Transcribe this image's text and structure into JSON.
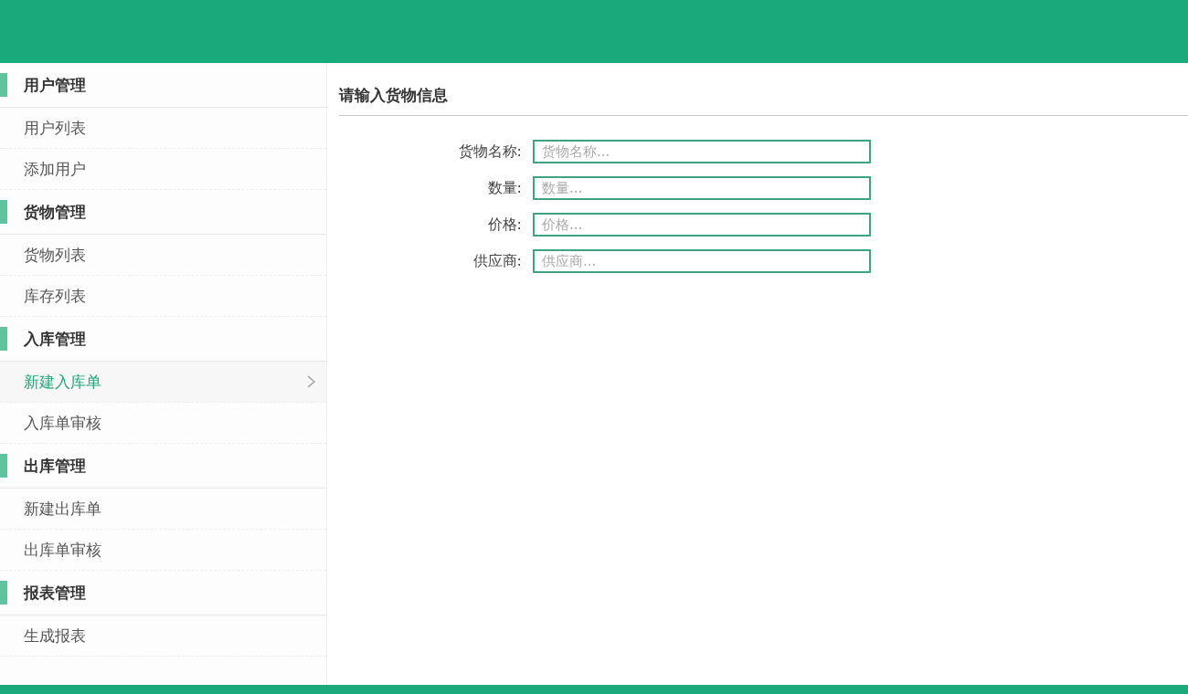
{
  "sidebar": {
    "groups": [
      {
        "title": "用户管理",
        "items": [
          {
            "label": "用户列表",
            "selected": false
          },
          {
            "label": "添加用户",
            "selected": false
          }
        ]
      },
      {
        "title": "货物管理",
        "items": [
          {
            "label": "货物列表",
            "selected": false
          },
          {
            "label": "库存列表",
            "selected": false
          }
        ]
      },
      {
        "title": "入库管理",
        "items": [
          {
            "label": "新建入库单",
            "selected": true
          },
          {
            "label": "入库单审核",
            "selected": false
          }
        ]
      },
      {
        "title": "出库管理",
        "items": [
          {
            "label": "新建出库单",
            "selected": false
          },
          {
            "label": "出库单审核",
            "selected": false
          }
        ]
      },
      {
        "title": "报表管理",
        "items": [
          {
            "label": "生成报表",
            "selected": false
          }
        ]
      }
    ]
  },
  "form": {
    "title": "请输入货物信息",
    "fields": [
      {
        "label": "货物名称:",
        "placeholder": "货物名称..."
      },
      {
        "label": "数量:",
        "placeholder": "数量..."
      },
      {
        "label": "价格:",
        "placeholder": "价格..."
      },
      {
        "label": "供应商:",
        "placeholder": "供应商..."
      }
    ]
  }
}
